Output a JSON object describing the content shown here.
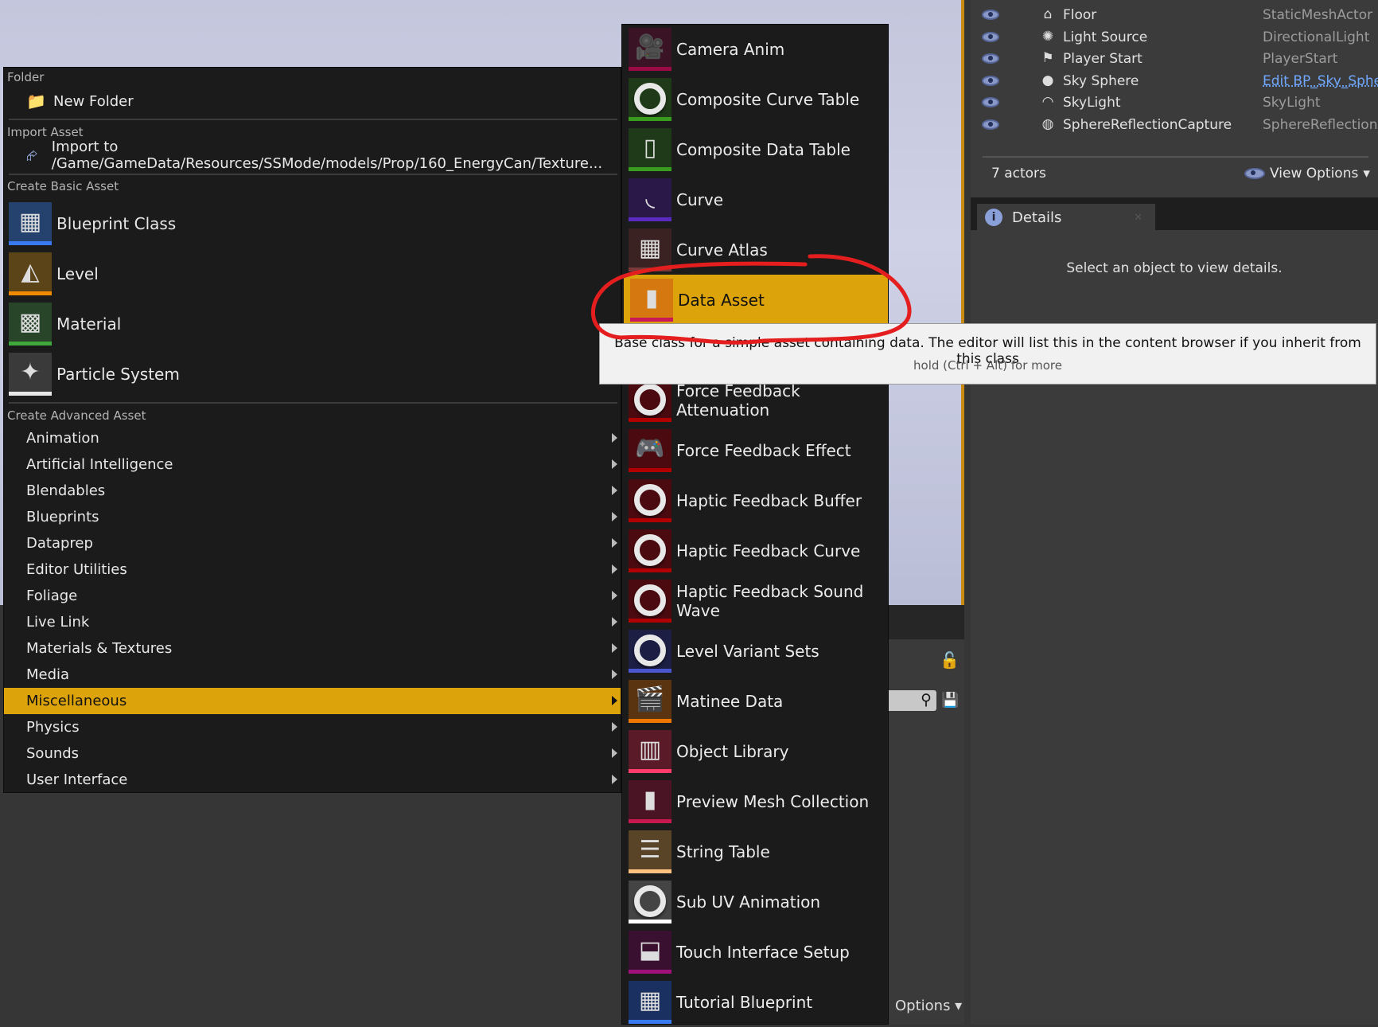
{
  "left_menu": {
    "folder_header": "Folder",
    "new_folder": "New Folder",
    "import_header": "Import Asset",
    "import_item": "Import to /Game/GameData/Resources/SSMode/models/Prop/160_EnergyCan/Texture...",
    "basic_header": "Create Basic Asset",
    "basic_items": [
      {
        "label": "Blueprint Class",
        "icon": "blueprint-icon",
        "bg": "#25426e",
        "bar": "#3a7af0",
        "glyph": "▦"
      },
      {
        "label": "Level",
        "icon": "level-icon",
        "bg": "#5a4418",
        "bar": "#f08a00",
        "glyph": "◭"
      },
      {
        "label": "Material",
        "icon": "material-icon",
        "bg": "#28452a",
        "bar": "#3fa83a",
        "glyph": "▩"
      },
      {
        "label": "Particle System",
        "icon": "particle-system-icon",
        "bg": "#3a3a3a",
        "bar": "#e8e8e8",
        "glyph": "✦"
      }
    ],
    "advanced_header": "Create Advanced Asset",
    "advanced_items": [
      "Animation",
      "Artificial Intelligence",
      "Blendables",
      "Blueprints",
      "Dataprep",
      "Editor Utilities",
      "Foliage",
      "Live Link",
      "Materials & Textures",
      "Media",
      "Miscellaneous",
      "Physics",
      "Sounds",
      "User Interface"
    ],
    "selected": "Miscellaneous"
  },
  "sub_menu": {
    "items": [
      {
        "label": "Camera Anim",
        "icon": "camera-anim-icon",
        "bg": "#3a1424",
        "bar": "#9a0a44",
        "glyph": "🎥"
      },
      {
        "label": "Composite Curve Table",
        "icon": "composite-curve-table-icon",
        "bg": "#1f3a18",
        "bar": "#3a9c1f",
        "ring": true
      },
      {
        "label": "Composite Data Table",
        "icon": "composite-data-table-icon",
        "bg": "#1f3a18",
        "bar": "#3a9c1f",
        "glyph": "▯"
      },
      {
        "label": "Curve",
        "icon": "curve-icon",
        "bg": "#2a1848",
        "bar": "#5a2bc0",
        "glyph": "◟"
      },
      {
        "label": "Curve Atlas",
        "icon": "curve-atlas-icon",
        "bg": "#3a2222",
        "bar": "#7a3a3a",
        "glyph": "▦"
      },
      {
        "label": "Data Asset",
        "icon": "data-asset-icon",
        "bg": "#d4780f",
        "bar": "#c8185a",
        "glyph": "▮",
        "selected": true
      },
      {
        "label": "Force Feedback Attenuation",
        "icon": "force-feedback-attenuation-icon",
        "bg": "#4a0a10",
        "bar": "#b00000",
        "ring": true
      },
      {
        "label": "Force Feedback Effect",
        "icon": "force-feedback-effect-icon",
        "bg": "#4a0a10",
        "bar": "#b00000",
        "glyph": "🎮"
      },
      {
        "label": "Haptic Feedback Buffer",
        "icon": "haptic-feedback-buffer-icon",
        "bg": "#4a0a10",
        "bar": "#b00000",
        "ring": true
      },
      {
        "label": "Haptic Feedback Curve",
        "icon": "haptic-feedback-curve-icon",
        "bg": "#4a0a10",
        "bar": "#b00000",
        "ring": true
      },
      {
        "label": "Haptic Feedback Sound Wave",
        "icon": "haptic-feedback-sound-wave-icon",
        "bg": "#4a0a10",
        "bar": "#b00000",
        "ring": true
      },
      {
        "label": "Level Variant Sets",
        "icon": "level-variant-sets-icon",
        "bg": "#1c1e44",
        "bar": "#4a56d0",
        "ring": true
      },
      {
        "label": "Matinee Data",
        "icon": "matinee-data-icon",
        "bg": "#5a3410",
        "bar": "#f07800",
        "glyph": "🎬"
      },
      {
        "label": "Object Library",
        "icon": "object-library-icon",
        "bg": "#5a1a28",
        "bar": "#ff3c6a",
        "glyph": "▥"
      },
      {
        "label": "Preview Mesh Collection",
        "icon": "preview-mesh-collection-icon",
        "bg": "#4a1424",
        "bar": "#c81850",
        "glyph": "▮"
      },
      {
        "label": "String Table",
        "icon": "string-table-icon",
        "bg": "#5a4428",
        "bar": "#ffc080",
        "glyph": "☰"
      },
      {
        "label": "Sub UV Animation",
        "icon": "sub-uv-animation-icon",
        "bg": "#444444",
        "bar": "#ffffff",
        "ring": true
      },
      {
        "label": "Touch Interface Setup",
        "icon": "touch-interface-setup-icon",
        "bg": "#3a1030",
        "bar": "#a0107a",
        "glyph": "⬓"
      },
      {
        "label": "Tutorial Blueprint",
        "icon": "tutorial-blueprint-icon",
        "bg": "#1a3060",
        "bar": "#3a7af0",
        "glyph": "▦"
      }
    ]
  },
  "tooltip": {
    "text": "Base class for a simple asset containing data. The editor will list this in the content browser if you inherit from this class",
    "hint": "hold (Ctrl + Alt) for more"
  },
  "outliner": {
    "rows": [
      {
        "name": "Floor",
        "type": "StaticMeshActor",
        "icon": "static-mesh-icon",
        "glyph": "⌂"
      },
      {
        "name": "Light Source",
        "type": "DirectionalLight",
        "icon": "directional-light-icon",
        "glyph": "✺"
      },
      {
        "name": "Player Start",
        "type": "PlayerStart",
        "icon": "player-start-icon",
        "glyph": "⚑"
      },
      {
        "name": "Sky Sphere",
        "type": "Edit BP_Sky_Sphere",
        "icon": "sky-sphere-icon",
        "glyph": "●",
        "link": true
      },
      {
        "name": "SkyLight",
        "type": "SkyLight",
        "icon": "skylight-icon",
        "glyph": "◠"
      },
      {
        "name": "SphereReflectionCapture",
        "type": "SphereReflectionCapture",
        "icon": "sphere-reflection-capture-icon",
        "glyph": "◍"
      }
    ],
    "count": "7 actors",
    "view_options": "View Options"
  },
  "details": {
    "tab": "Details",
    "empty": "Select an object to view details."
  },
  "content_browser": {
    "options": "Options"
  },
  "colors": {
    "highlight": "#dca30a",
    "annotation": "#e41e1e"
  }
}
